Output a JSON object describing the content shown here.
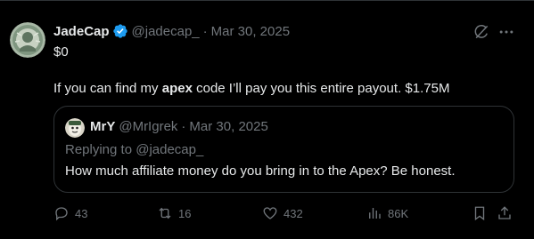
{
  "tweet": {
    "author_name": "JadeCap",
    "handle": "@jadecap_",
    "separator": "·",
    "date": "Mar 30, 2025",
    "line1": "$0",
    "line2_pre": "If you can find my ",
    "line2_bold": "apex",
    "line2_post": " code I’ll pay you this entire payout. $1.75M"
  },
  "quote": {
    "author_name": "MrY",
    "handle": "@MrIgrek",
    "separator": "·",
    "date": "Mar 30, 2025",
    "replying_prefix": "Replying to ",
    "replying_handle": "@jadecap_",
    "text": "How much affiliate money do you bring in to the Apex? Be honest."
  },
  "actions": {
    "replies": "43",
    "reposts": "16",
    "likes": "432",
    "views": "86K"
  },
  "colors": {
    "background": "#000000",
    "text": "#e7e9ea",
    "muted": "#71767b",
    "verified": "#1d9bf0",
    "border": "#2f3336"
  },
  "icons": [
    "verified-badge-icon",
    "grok-icon",
    "more-icon",
    "reply-icon",
    "repost-icon",
    "like-icon",
    "views-icon",
    "bookmark-icon",
    "share-icon"
  ]
}
